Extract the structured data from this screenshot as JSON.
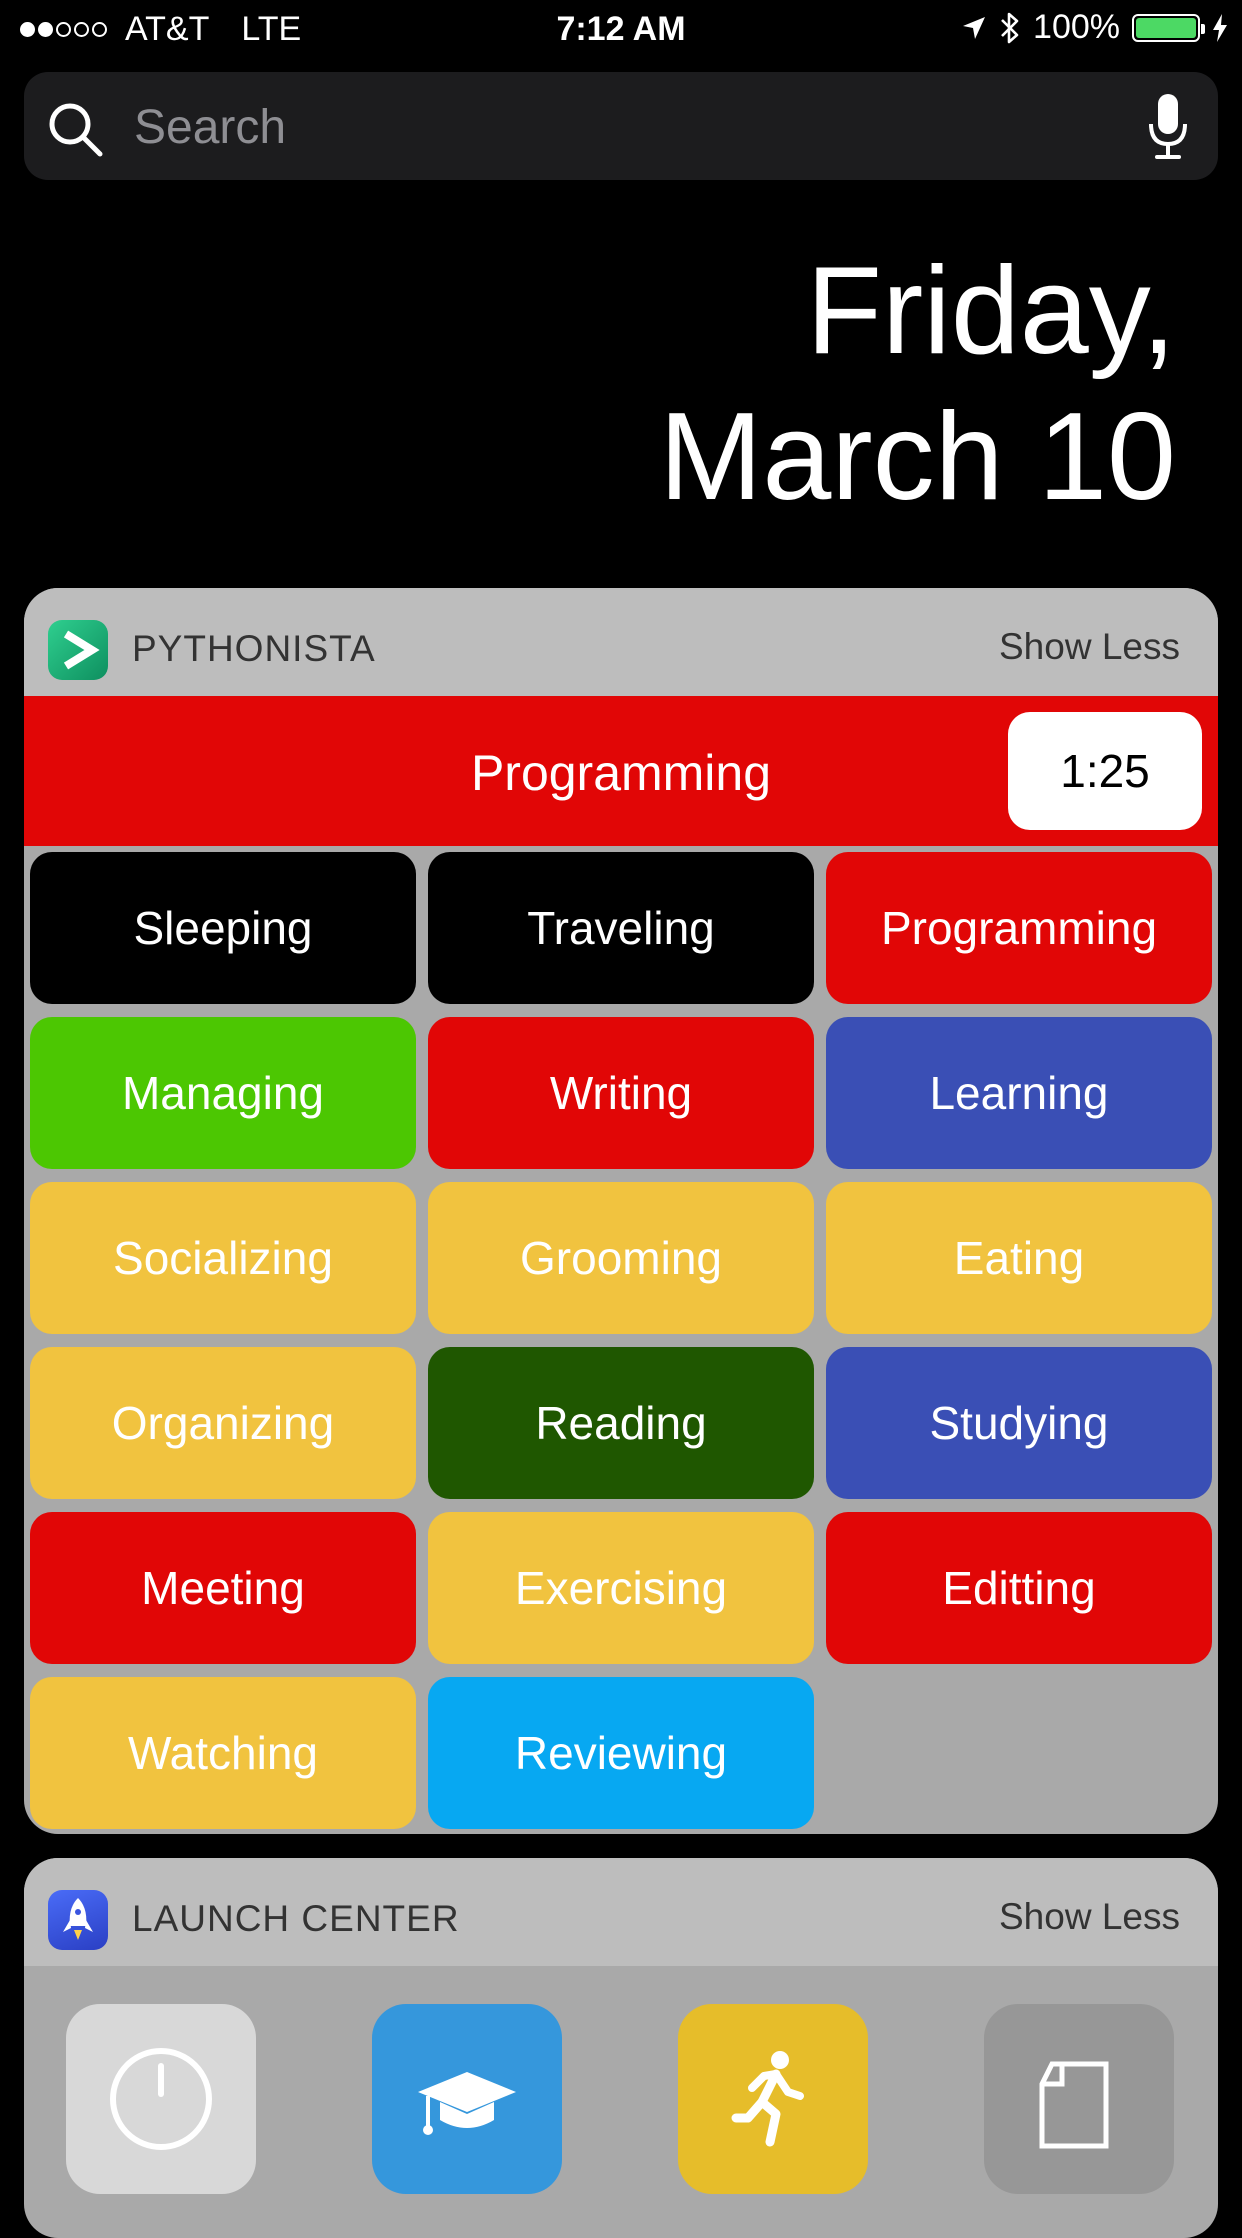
{
  "status": {
    "signal_bars_filled": 2,
    "signal_bars_total": 5,
    "carrier": "AT&T",
    "network": "LTE",
    "time": "7:12 AM",
    "battery_percent": "100%",
    "battery_level": 1.0
  },
  "search": {
    "placeholder": "Search"
  },
  "date": {
    "line1": "Friday,",
    "line2": "March 10"
  },
  "pythonista": {
    "app_name": "PYTHONISTA",
    "toggle_label": "Show Less",
    "current_activity": "Programming",
    "timer": "1:25",
    "activities": [
      {
        "label": "Sleeping",
        "color": "#000000"
      },
      {
        "label": "Traveling",
        "color": "#000000"
      },
      {
        "label": "Programming",
        "color": "#e10606"
      },
      {
        "label": "Managing",
        "color": "#4cc702"
      },
      {
        "label": "Writing",
        "color": "#e10606"
      },
      {
        "label": "Learning",
        "color": "#3a4fb5"
      },
      {
        "label": "Socializing",
        "color": "#f1c33f"
      },
      {
        "label": "Grooming",
        "color": "#f1c33f"
      },
      {
        "label": "Eating",
        "color": "#f1c33f"
      },
      {
        "label": "Organizing",
        "color": "#f1c33f"
      },
      {
        "label": "Reading",
        "color": "#1f5700"
      },
      {
        "label": "Studying",
        "color": "#3a4fb5"
      },
      {
        "label": "Meeting",
        "color": "#e10606"
      },
      {
        "label": "Exercising",
        "color": "#f1c33f"
      },
      {
        "label": "Editting",
        "color": "#e10606"
      },
      {
        "label": "Watching",
        "color": "#f1c33f"
      },
      {
        "label": "Reviewing",
        "color": "#07a8f2"
      }
    ]
  },
  "launch_center": {
    "app_name": "LAUNCH CENTER",
    "toggle_label": "Show Less",
    "actions": [
      {
        "icon": "clock-icon",
        "color": "#d8d8d8"
      },
      {
        "icon": "graduation-cap-icon",
        "color": "#3597dc"
      },
      {
        "icon": "running-person-icon",
        "color": "#e6bd2a"
      },
      {
        "icon": "document-icon",
        "color": "#979797"
      }
    ]
  }
}
